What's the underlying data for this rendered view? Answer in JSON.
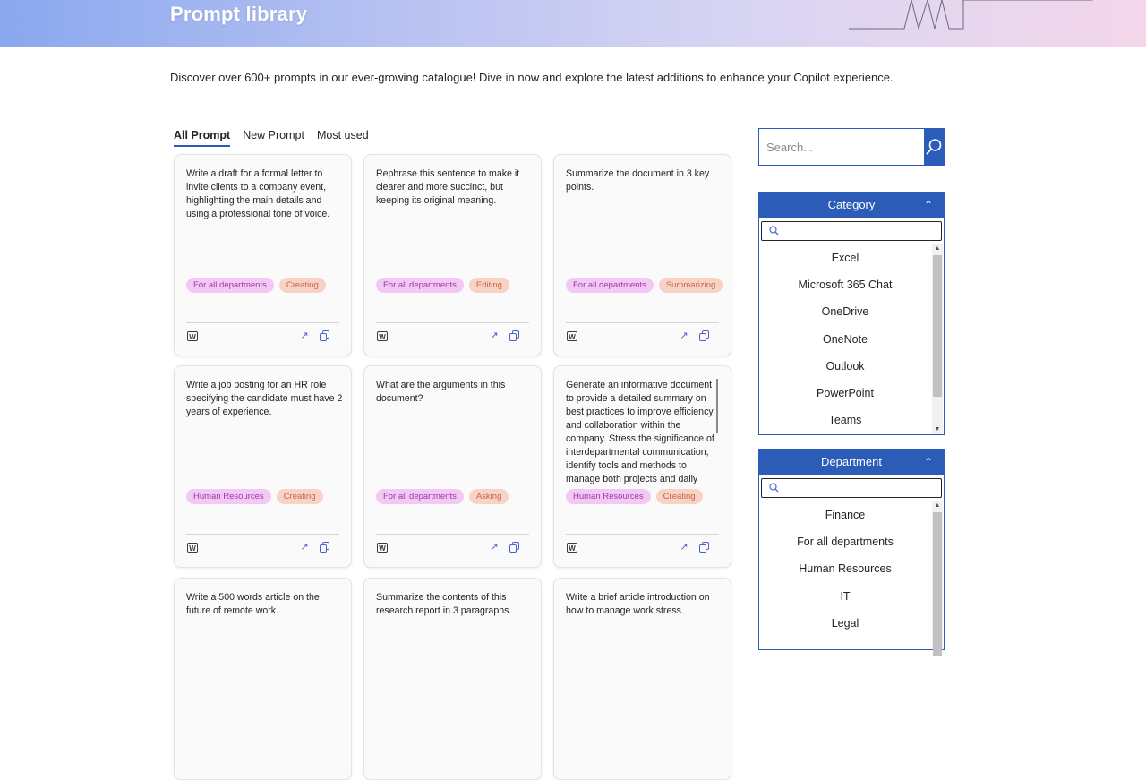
{
  "header": {
    "title": "Prompt library"
  },
  "intro": "Discover over 600+ prompts in our ever-growing catalogue! Dive in now and explore the latest additions to enhance your Copilot experience.",
  "tabs": [
    {
      "label": "All Prompt",
      "active": true
    },
    {
      "label": "New Prompt",
      "active": false
    },
    {
      "label": "Most used",
      "active": false
    }
  ],
  "cards": [
    {
      "text": "Write a draft for a formal letter to invite clients to a company event, highlighting the main details and using a professional tone of voice.",
      "department": "For all departments",
      "activity": "Creating",
      "app_icon": "word-icon"
    },
    {
      "text": "Rephrase this sentence to make it clearer and more succinct, but keeping its original meaning.",
      "department": "For all departments",
      "activity": "Editing",
      "app_icon": "word-icon"
    },
    {
      "text": "Summarize the document in 3 key points.",
      "department": "For all departments",
      "activity": "Summarizing",
      "app_icon": "word-icon"
    },
    {
      "text": "Write a job posting for an HR role specifying the candidate must have 2 years of experience.",
      "department": "Human Resources",
      "activity": "Creating",
      "app_icon": "word-icon"
    },
    {
      "text": "What are the arguments in this document?",
      "department": "For all departments",
      "activity": "Asking",
      "app_icon": "word-icon"
    },
    {
      "text": "Generate an informative document to provide a detailed summary on best practices to improve efficiency and collaboration within the company. Stress the significance of interdepartmental communication, identify tools and methods to manage both projects and daily",
      "department": "Human Resources",
      "activity": "Creating",
      "app_icon": "word-icon"
    },
    {
      "text": "Write a 500 words article on the future of remote work.",
      "department": "",
      "activity": "",
      "app_icon": "word-icon"
    },
    {
      "text": "Summarize the contents of this research report in 3 paragraphs.",
      "department": "",
      "activity": "",
      "app_icon": "word-icon"
    },
    {
      "text": "Write a brief article introduction on how to manage work stress.",
      "department": "",
      "activity": "",
      "app_icon": "word-icon"
    }
  ],
  "search": {
    "placeholder": "Search...",
    "icon": "search-icon"
  },
  "category": {
    "title": "Category",
    "items": [
      "Excel",
      "Microsoft 365 Chat",
      "OneDrive",
      "OneNote",
      "Outlook",
      "PowerPoint",
      "Teams"
    ]
  },
  "department": {
    "title": "Department",
    "items": [
      "Finance",
      "For all departments",
      "Human Resources",
      "IT",
      "Legal"
    ]
  },
  "colors": {
    "accent": "#2b5cb8",
    "dept_tag_bg": "#f3c8f4",
    "activity_tag_bg": "#f9d2c6",
    "action_icon": "#4b5fd0"
  }
}
